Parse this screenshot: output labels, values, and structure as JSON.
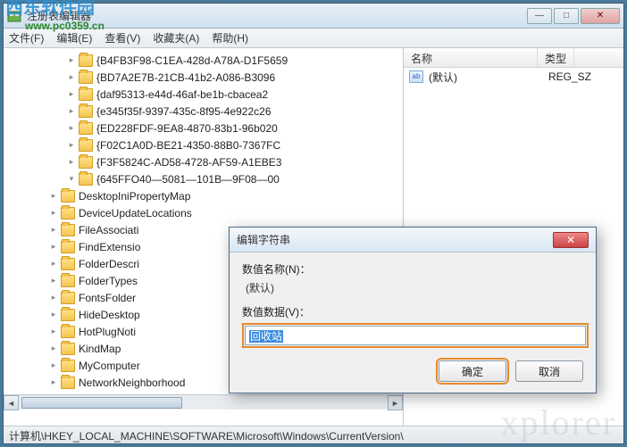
{
  "window": {
    "title": "注册表编辑器",
    "menu": {
      "file": "文件(F)",
      "edit": "编辑(E)",
      "view": "查看(V)",
      "fav": "收藏夹(A)",
      "help": "帮助(H)"
    },
    "watermark": "西东软件园",
    "watermark_url": "www.pc0359.cn"
  },
  "tree": {
    "guids": [
      "{B4FB3F98-C1EA-428d-A78A-D1F5659",
      "{BD7A2E7B-21CB-41b2-A086-B3096",
      "{daf95313-e44d-46af-be1b-cbacea2",
      "{e345f35f-9397-435c-8f95-4e922c26",
      "{ED228FDF-9EA8-4870-83b1-96b020",
      "{F02C1A0D-BE21-4350-88B0-7367FC",
      "{F3F5824C-AD58-4728-AF59-A1EBE3",
      "{645FFO40—5081—101B—9F08—00"
    ],
    "keys": [
      "DesktopIniPropertyMap",
      "DeviceUpdateLocations",
      "FileAssociati",
      "FindExtensio",
      "FolderDescri",
      "FolderTypes",
      "FontsFolder",
      "HideDesktop",
      "HotPlugNoti",
      "KindMap",
      "MyComputer",
      "NetworkNeighborhood"
    ]
  },
  "list": {
    "headers": {
      "name": "名称",
      "type": "类型"
    },
    "row": {
      "name": "(默认)",
      "type": "REG_SZ"
    }
  },
  "dialog": {
    "title": "编辑字符串",
    "name_label": "数值名称(N)：",
    "name_value": "(默认)",
    "data_label": "数值数据(V)：",
    "data_value": "回收站",
    "ok": "确定",
    "cancel": "取消"
  },
  "status": "计算机\\HKEY_LOCAL_MACHINE\\SOFTWARE\\Microsoft\\Windows\\CurrentVersion\\",
  "bg_text": "xplorer"
}
